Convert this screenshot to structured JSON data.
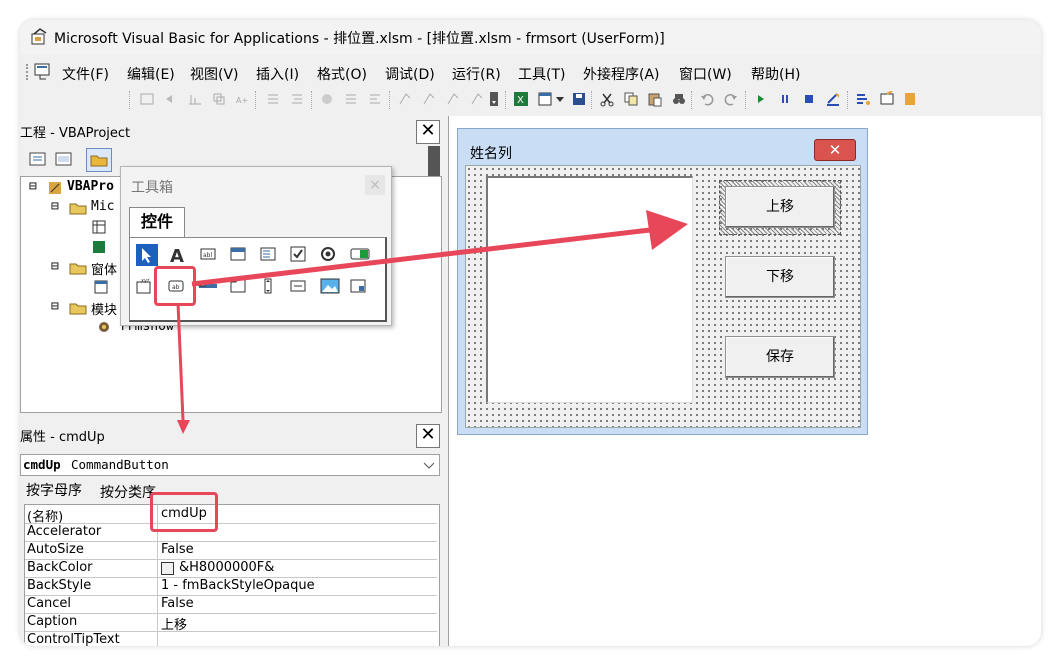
{
  "window": {
    "title": "Microsoft Visual Basic for Applications - 排位置.xlsm - [排位置.xlsm - frmsort (UserForm)]"
  },
  "menu": {
    "items": [
      "文件(F)",
      "编辑(E)",
      "视图(V)",
      "插入(I)",
      "格式(O)",
      "调试(D)",
      "运行(R)",
      "工具(T)",
      "外接程序(A)",
      "窗口(W)",
      "帮助(H)"
    ]
  },
  "project_panel": {
    "title": "工程 - VBAProject",
    "close": "✕",
    "tree": {
      "root": "VBAPro",
      "microsoft": "Mic",
      "forms_folder": "窗体",
      "modules_folder": "模块",
      "module_item": "frmshow"
    }
  },
  "toolbox": {
    "title": "工具箱",
    "close": "×",
    "tab": "控件"
  },
  "properties_panel": {
    "title": "属性 - cmdUp",
    "close": "✕",
    "object_name": "cmdUp",
    "object_type": "CommandButton",
    "tabs": [
      "按字母序",
      "按分类序"
    ],
    "rows": [
      {
        "name": "(名称)",
        "value": "cmdUp"
      },
      {
        "name": "Accelerator",
        "value": ""
      },
      {
        "name": "AutoSize",
        "value": "False"
      },
      {
        "name": "BackColor",
        "value": "&H8000000F&"
      },
      {
        "name": "BackStyle",
        "value": "1 - fmBackStyleOpaque"
      },
      {
        "name": "Cancel",
        "value": "False"
      },
      {
        "name": "Caption",
        "value": "上移"
      },
      {
        "name": "ControlTipText",
        "value": ""
      }
    ]
  },
  "userform": {
    "caption": "姓名列",
    "buttons": {
      "up": "上移",
      "down": "下移",
      "save": "保存"
    }
  },
  "colors": {
    "annotation_red": "#e8475a",
    "form_titlebar": "#c9def5",
    "close_red": "#d9534f"
  }
}
